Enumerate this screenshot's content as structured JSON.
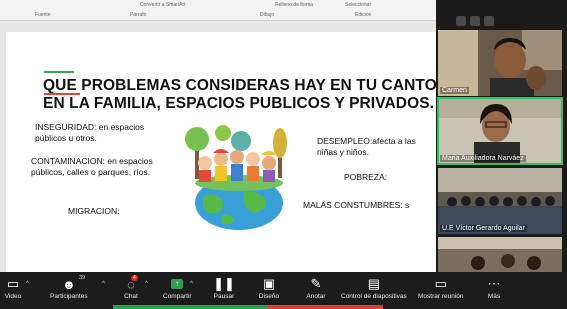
{
  "ribbon": {
    "row1": [
      "Convertir a SmartArt",
      "Relleno de forma",
      "Seleccionar"
    ],
    "row2": [
      "Fuente",
      "Párrafo",
      "Dibujo",
      "Edición"
    ]
  },
  "slide": {
    "title_line1": "QUE PROBLEMAS CONSIDERAS HAY EN TU CANTON,",
    "title_line2": "EN LA FAMILIA, ESPACIOS PUBLICOS Y PRIVADOS.",
    "inseguridad": "INSEGURIDAD: en espacios públicos u otros.",
    "contaminacion": "CONTAMINACION: en espacios públicos, calles o parques, ríos.",
    "migracion": "MIGRACION:",
    "desempleo": "DESEMPLEO:afecta a las niñas y niños.",
    "pobreza": "POBREZA:",
    "malas": "MALAS CONSTUMBRES:  s"
  },
  "participants": [
    {
      "name": "Carmen"
    },
    {
      "name": "Maria Auxiliadora Narváez"
    },
    {
      "name": "U.E Víctor Gerardo Aguilar"
    },
    {
      "name": ""
    }
  ],
  "toolbar": {
    "video": "Video",
    "participants": "Participantes",
    "participants_count": "39",
    "chat": "Chat",
    "chat_badge": "4",
    "share": "Compartir",
    "pause": "Pausar",
    "design": "Diseño",
    "annotate": "Anotar",
    "slide_control": "Control de diapositivas",
    "show_meeting": "Mostrar reunión",
    "more": "Más"
  },
  "colors": {
    "share_green": "#2e9e4f",
    "stop_red": "#d9403a",
    "active_speaker": "#2ec15c"
  }
}
